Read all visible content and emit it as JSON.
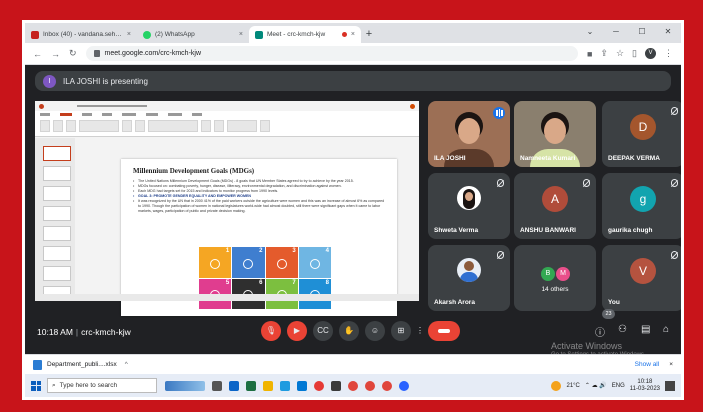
{
  "browser": {
    "tabs": [
      {
        "label": "Inbox (40) - vandana.sehgal@m...",
        "active": false,
        "color": "#c5221f"
      },
      {
        "label": "(2) WhatsApp",
        "active": false,
        "color": "#25d366"
      },
      {
        "label": "Meet - crc-kmch-kjw",
        "active": true,
        "color": "#00897b"
      }
    ],
    "new_tab": "+",
    "url": "meet.google.com/crc-kmch-kjw",
    "profile_initial": "V"
  },
  "presenting": {
    "avatar_initial": "I",
    "text": "ILA JOSHI is presenting"
  },
  "slide": {
    "title": "Millennium Development Goals (MDGs)",
    "bullets": [
      "The United Nations Millennium Development Goals (MDGs) - 8 goals that UN Member States agreed to try to achieve by the year 2015.",
      "MDGs focused on: combating poverty, hunger, disease, illiteracy, environmental degradation, and discrimination against women.",
      "Each MDG had targets set for 2015 and indicators to monitor progress from 1990 levels.",
      "GOAL 3: PROMOTE GENDER EQUALITY AND EMPOWER WOMEN",
      "It was recognized by the UN that in 2000 41% of the paid workers outside the agriculture were women and this was an increase of almost 6% as compared to 1990. Though the participation of women in national legislatures world-wide had almost doubled, still there were significant gaps when it came to labor markets, wages, participation of public and private decision making."
    ],
    "goals": [
      {
        "number": "1",
        "color": "#f5a623"
      },
      {
        "number": "2",
        "color": "#3f7ecf"
      },
      {
        "number": "3",
        "color": "#e45b2c"
      },
      {
        "number": "4",
        "color": "#6fb6e3"
      },
      {
        "number": "5",
        "color": "#e03d8f"
      },
      {
        "number": "6",
        "color": "#2f2f2f"
      },
      {
        "number": "7",
        "color": "#7cbf3f"
      },
      {
        "number": "8",
        "color": "#1f8fd6"
      }
    ]
  },
  "participants": [
    {
      "name": "ILA JOSHI",
      "type": "video"
    },
    {
      "name": "Namneeta Kumari",
      "type": "video"
    },
    {
      "name": "DEEPAK VERMA",
      "initial": "D",
      "color": "#a4562d"
    },
    {
      "name": "Shweta Verma",
      "type": "photo"
    },
    {
      "name": "ANSHU BANWARI",
      "initial": "A",
      "color": "#b04c3a"
    },
    {
      "name": "gaurika chugh",
      "initial": "g",
      "color": "#12a4af"
    },
    {
      "name": "Akarsh Arora",
      "type": "photo"
    },
    {
      "others_label": "14 others",
      "mini": [
        "B",
        "M"
      ]
    },
    {
      "name": "You",
      "initial": "V",
      "color": "#b5533f"
    }
  ],
  "meeting": {
    "time": "10:18 AM",
    "separator": "|",
    "code": "crc-kmch-kjw",
    "people_count": "23"
  },
  "activate": {
    "line1": "Activate Windows",
    "line2": "Go to Settings to activate Windows."
  },
  "downloads": {
    "file": "Department_publi....xlsx",
    "caret": "^",
    "show_all": "Show all",
    "close": "×"
  },
  "taskbar": {
    "search_placeholder": "Type here to search",
    "temperature": "21°C",
    "lang": "ENG",
    "time": "10:18",
    "date": "11-03-2023"
  }
}
